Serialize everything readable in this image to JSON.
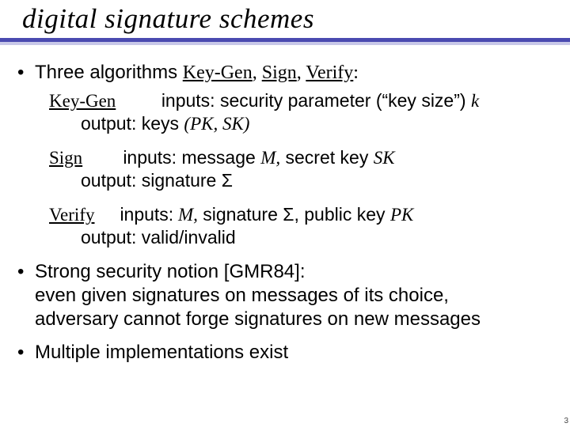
{
  "title": "digital signature schemes",
  "bullet1": {
    "pre": "Three algorithms ",
    "kg": "Key-Gen",
    "c1": ", ",
    "sg": "Sign",
    "c2": ", ",
    "vf": "Verify",
    "post": ":"
  },
  "keygen": {
    "name": "Key-Gen",
    "inlabel": "inputs:",
    "indesc": " security parameter (“key size”) ",
    "k": "k",
    "outlabel": "output:",
    "outdesc1": " keys ",
    "outdesc2": "(PK, SK)"
  },
  "sign": {
    "name": "Sign",
    "inlabel": "inputs:",
    "indesc1": " message ",
    "M": "M,",
    "indesc2": "  secret key ",
    "SK": "SK",
    "outlabel": "output:",
    "outdesc": " signature Σ"
  },
  "verify": {
    "name": "Verify",
    "inlabel": "inputs:",
    "M": " M,",
    "indesc1": "  signature Σ, public key ",
    "PK": "PK",
    "outlabel": "output:",
    "outdesc": " valid/invalid"
  },
  "bullet2": {
    "l1": "Strong security notion [GMR84]:",
    "l2": "even given signatures on messages of its choice,",
    "l3": "adversary cannot forge signatures on new messages"
  },
  "bullet3": "Multiple implementations exist",
  "dot": "•",
  "pagenum": "3"
}
